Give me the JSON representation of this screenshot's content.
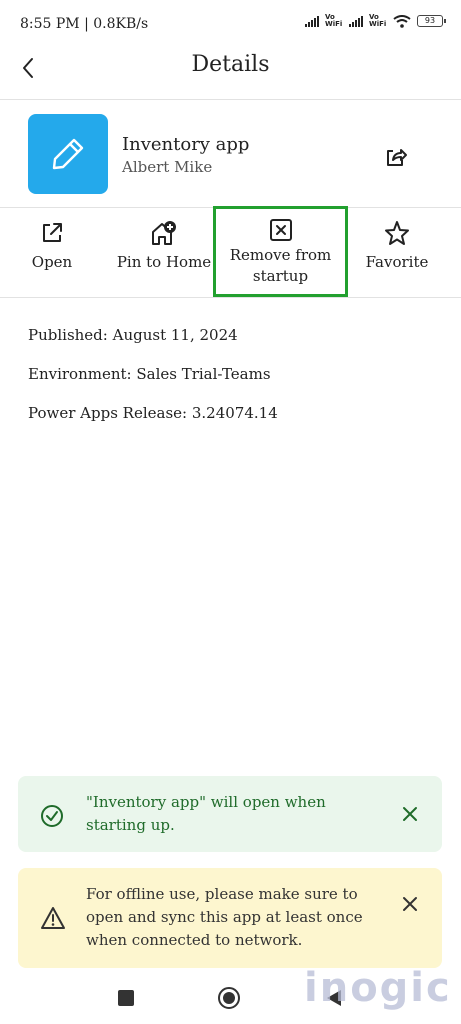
{
  "status_bar": {
    "time": "8:55 PM | 0.8KB/s",
    "vowifi_1": "Vo WiFi",
    "vowifi_2": "Vo WiFi",
    "battery": "93"
  },
  "header": {
    "title": "Details",
    "back_icon": "chevron-left-icon"
  },
  "app": {
    "name": "Inventory app",
    "owner": "Albert Mike",
    "icon": "pencil-icon",
    "icon_color": "#24a9eb"
  },
  "actions": [
    {
      "label": "Open",
      "icon": "open-external-icon"
    },
    {
      "label": "Pin to Home",
      "icon": "pin-home-icon"
    },
    {
      "label_line1": "Remove from",
      "label_line2": "startup",
      "icon": "remove-box-icon",
      "highlight_color": "#22a02f"
    },
    {
      "label": "Favorite",
      "icon": "star-icon"
    }
  ],
  "details": {
    "published": "Published: August 11, 2024",
    "environment": "Environment: Sales Trial-Teams",
    "release": "Power Apps Release: 3.24074.14"
  },
  "toasts": {
    "success": {
      "text": "\"Inventory app\" will open when starting up.",
      "bg": "#eaf6ec",
      "color": "#1f6b2a"
    },
    "warning": {
      "text": "For offline use, please make sure to open and sync this app at least once when connected to network.",
      "bg": "#fdf6cf"
    }
  },
  "watermark": "inogic"
}
